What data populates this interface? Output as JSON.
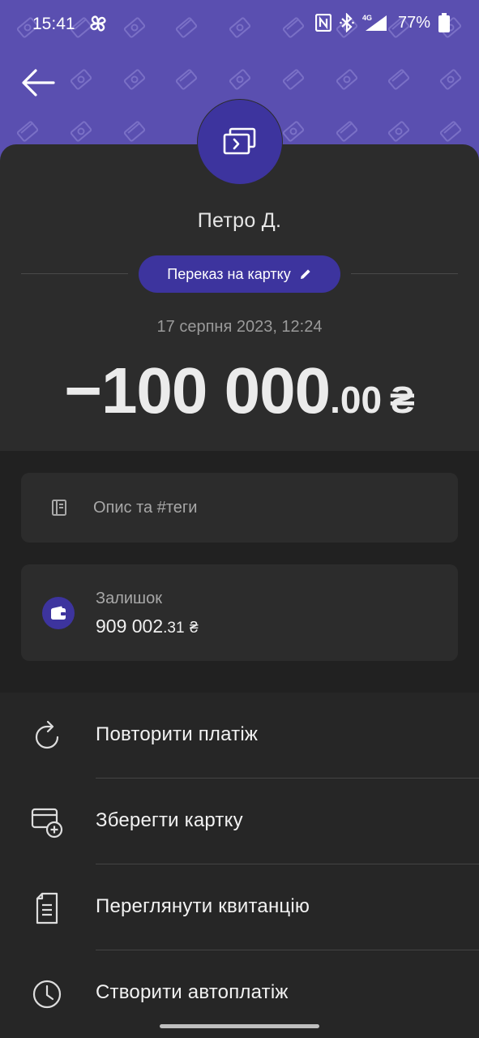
{
  "status_bar": {
    "time": "15:41",
    "network": "4G",
    "battery": "77%"
  },
  "header": {
    "back_label": "Back"
  },
  "transaction": {
    "recipient": "Петро Д.",
    "type_label": "Переказ на картку",
    "datetime": "17 серпня 2023, 12:24",
    "amount_main": "−100 000",
    "amount_cents": ".00",
    "currency": "₴"
  },
  "description": {
    "placeholder": "Опис та #теги"
  },
  "balance": {
    "label": "Залишок",
    "value_main": "909 002",
    "value_cents": ".31",
    "currency": "₴"
  },
  "actions": [
    {
      "label": "Повторити платіж",
      "icon": "repeat-icon"
    },
    {
      "label": "Зберегти картку",
      "icon": "add-card-icon"
    },
    {
      "label": "Переглянути квитанцію",
      "icon": "receipt-icon"
    },
    {
      "label": "Створити автоплатіж",
      "icon": "clock-icon"
    }
  ],
  "colors": {
    "header": "#5a4fb0",
    "accent": "#3d349e",
    "sheet": "#2c2c2c",
    "background": "#262626"
  }
}
